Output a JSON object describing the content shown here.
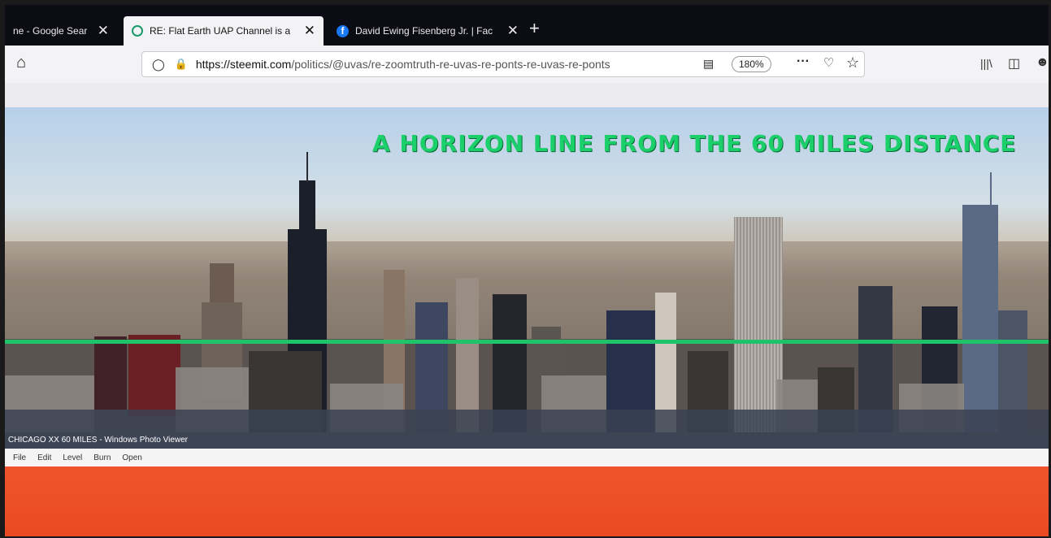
{
  "tabs": [
    {
      "title": "ne - Google Sear",
      "active": false
    },
    {
      "title": "RE: Flat Earth UAP Channel is a",
      "active": true
    },
    {
      "title": "David Ewing Fisenberg Jr. | Fac",
      "active": false
    }
  ],
  "tab_close_glyph": "✕",
  "new_tab_glyph": "+",
  "nav": {
    "url_host": "https://steemit.com",
    "url_path": "/politics/@uvas/re-zoomtruth-re-uvas-re-ponts-re-uvas-re-ponts",
    "zoom": "180%",
    "more_glyph": "···"
  },
  "photo": {
    "headline": "A HORIZON LINE FROM THE 60 MILES DISTANCE",
    "horizon_line_color": "#1fc46a"
  },
  "app": {
    "caption": "CHICAGO XX 60 MILES - Windows Photo Viewer",
    "menus": [
      "File",
      "Edit",
      "Level",
      "Burn",
      "Open"
    ]
  },
  "colors": {
    "orange": "#ef5126",
    "headline": "#1bd06b"
  }
}
